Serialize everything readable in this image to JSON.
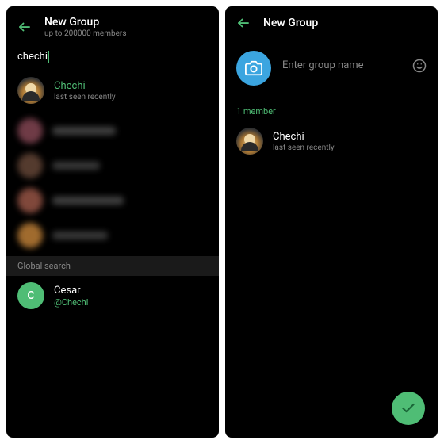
{
  "left": {
    "header": {
      "title": "New Group",
      "subtitle": "up to 200000 members"
    },
    "search": {
      "query": "chechi"
    },
    "top_contact": {
      "name": "Chechi",
      "status": "last seen recently"
    },
    "section_label": "Global search",
    "global_contact": {
      "name": "Cesar",
      "handle": "@Chechi",
      "letter": "C"
    }
  },
  "right": {
    "header": {
      "title": "New Group"
    },
    "input": {
      "placeholder": "Enter group name"
    },
    "members_label": "1 member",
    "member": {
      "name": "Chechi",
      "status": "last seen recently"
    }
  }
}
